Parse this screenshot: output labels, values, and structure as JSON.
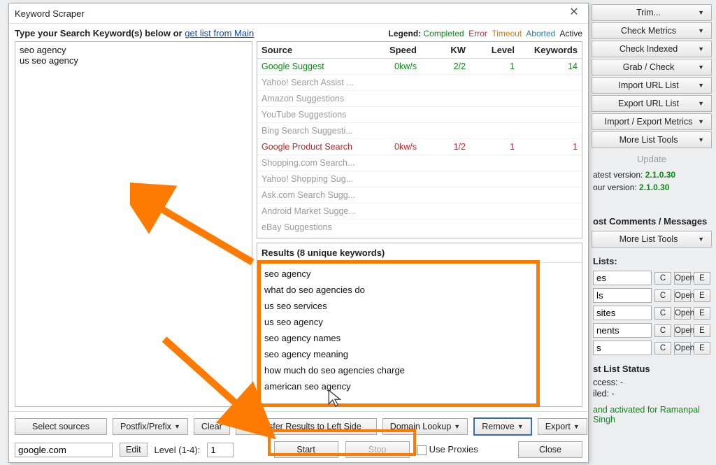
{
  "dialog": {
    "title": "Keyword Scraper",
    "prompt_bold": "Type your Search Keyword(s) below or",
    "prompt_link": "get list from Main",
    "legend": {
      "label": "Legend:",
      "completed": "Completed",
      "error": "Error",
      "timeout": "Timeout",
      "aborted": "Aborted",
      "active": "Active"
    },
    "keywords_text": "seo agency\nus seo agency",
    "sources": {
      "head": [
        "Source",
        "Speed",
        "KW",
        "Level",
        "Keywords"
      ],
      "rows": [
        {
          "name": "Google Suggest",
          "speed": "0kw/s",
          "kw": "2/2",
          "level": "1",
          "keywords": "14",
          "state": "completed"
        },
        {
          "name": "Yahoo! Search Assist ...",
          "speed": "",
          "kw": "",
          "level": "",
          "keywords": "",
          "state": "idle"
        },
        {
          "name": "Amazon Suggestions",
          "speed": "",
          "kw": "",
          "level": "",
          "keywords": "",
          "state": "idle"
        },
        {
          "name": "YouTube Suggestions",
          "speed": "",
          "kw": "",
          "level": "",
          "keywords": "",
          "state": "idle"
        },
        {
          "name": "Bing Search Suggesti...",
          "speed": "",
          "kw": "",
          "level": "",
          "keywords": "",
          "state": "idle"
        },
        {
          "name": "Google Product Search",
          "speed": "0kw/s",
          "kw": "1/2",
          "level": "1",
          "keywords": "1",
          "state": "error"
        },
        {
          "name": "Shopping.com Search...",
          "speed": "",
          "kw": "",
          "level": "",
          "keywords": "",
          "state": "idle"
        },
        {
          "name": "Yahoo! Shopping Sug...",
          "speed": "",
          "kw": "",
          "level": "",
          "keywords": "",
          "state": "idle"
        },
        {
          "name": "Ask.com Search Sugg...",
          "speed": "",
          "kw": "",
          "level": "",
          "keywords": "",
          "state": "idle"
        },
        {
          "name": "Android Market Sugge...",
          "speed": "",
          "kw": "",
          "level": "",
          "keywords": "",
          "state": "idle"
        },
        {
          "name": "eBay Suggestions",
          "speed": "",
          "kw": "",
          "level": "",
          "keywords": "",
          "state": "idle"
        }
      ]
    },
    "results": {
      "header": "Results (8 unique keywords)",
      "items": [
        "seo agency",
        "what do seo agencies do",
        "us seo services",
        "us seo agency",
        "seo agency names",
        "seo agency meaning",
        "how much do seo agencies charge",
        "american seo agency"
      ]
    },
    "toolbar": {
      "select_sources": "Select sources",
      "postfix": "Postfix/Prefix",
      "clear": "Clear",
      "transfer": "Transfer Results to Left Side",
      "domain_lookup": "Domain Lookup",
      "remove": "Remove",
      "export": "Export"
    },
    "toolbar2": {
      "footprint": "google.com",
      "edit": "Edit",
      "level_label": "Level (1-4):",
      "level_value": "1",
      "start": "Start",
      "stop": "Stop",
      "use_proxies": "Use Proxies",
      "close": "Close"
    }
  },
  "side": {
    "menu": [
      "Trim...",
      "Check Metrics",
      "Check Indexed",
      "Grab / Check",
      "Import URL List",
      "Export URL List",
      "Import / Export Metrics",
      "More List Tools"
    ],
    "update_label": "Update",
    "version": {
      "latest_label": "atest version:",
      "latest": "2.1.0.30",
      "your_label": "our version:",
      "your": "2.1.0.30"
    },
    "comments_header": "ost Comments / Messages",
    "lists_header": "Lists:",
    "lists": [
      "es",
      "ls",
      "sites",
      "nents",
      "s"
    ],
    "status_header": "st List Status",
    "status": {
      "success_label": "ccess:",
      "success_val": "-",
      "failed_label": "iled:",
      "failed_val": "-"
    },
    "activated": "and activated for Ramanpal Singh"
  }
}
